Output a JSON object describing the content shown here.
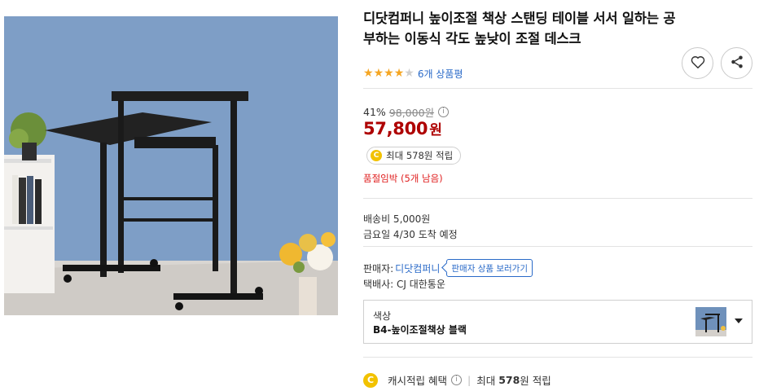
{
  "product": {
    "title": "디닷컴퍼니 높이조절 책상 스탠딩 테이블 서서 일하는 공부하는 이동식 각도 높낮이 조절 데스크",
    "rating": 4,
    "rating_max": 5,
    "review_count": "6개 상품평"
  },
  "icons": {
    "wishlist": "heart-icon",
    "share": "share-icon",
    "info": "info-icon",
    "point": "coin-icon",
    "dropdown": "chevron-down-icon"
  },
  "price": {
    "discount_rate": "41%",
    "original_price": "98,000원",
    "info_symbol": "i",
    "sale_amount": "57,800",
    "sale_unit": "원"
  },
  "points": {
    "coin_symbol": "C",
    "label": "최대 578원 적립"
  },
  "stock_notice": "품절임박 (5개 남음)",
  "shipping": {
    "fee": "배송비 5,000원",
    "arrival": "금요일 4/30 도착 예정"
  },
  "seller": {
    "label": "판매자:",
    "name": "디닷컴퍼니",
    "button": "판매자 상품 보러가기",
    "courier": "택배사: CJ 대한통운"
  },
  "option": {
    "label": "색상",
    "value": "B4-높이조절책상 블랙"
  },
  "cash_benefit": {
    "label": "캐시적립 혜택",
    "separator": "|",
    "prefix": "최대",
    "amount": "578",
    "suffix": "원 적립"
  },
  "colors": {
    "accent_price": "#ae0000",
    "link": "#2a6ac8",
    "star": "#f5a623",
    "stock": "#e02020",
    "coin": "#f2c200"
  }
}
